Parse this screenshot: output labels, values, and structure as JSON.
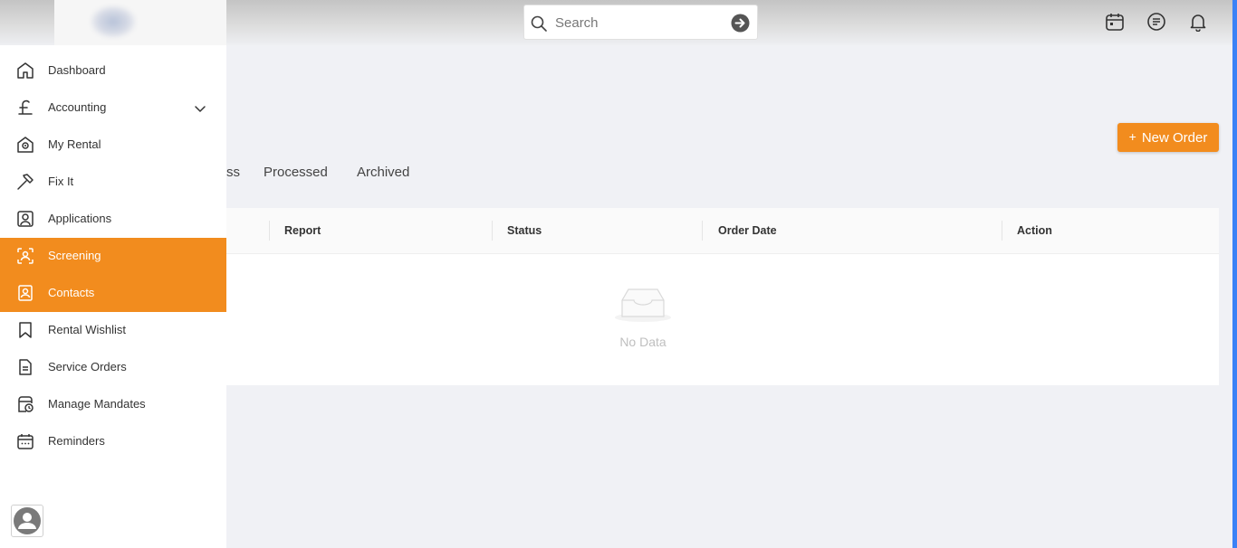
{
  "search": {
    "placeholder": "Search"
  },
  "sidebar": {
    "items": [
      {
        "label": "Dashboard",
        "icon": "home-icon"
      },
      {
        "label": "Accounting",
        "icon": "pound-icon"
      },
      {
        "label": "My Rental",
        "icon": "rental-icon"
      },
      {
        "label": "Fix It",
        "icon": "hammer-icon"
      },
      {
        "label": "Applications",
        "icon": "applications-icon"
      },
      {
        "label": "Screening",
        "icon": "screening-icon"
      },
      {
        "label": "Contacts",
        "icon": "contacts-icon"
      },
      {
        "label": "Rental Wishlist",
        "icon": "bookmark-icon"
      },
      {
        "label": "Service Orders",
        "icon": "document-icon"
      },
      {
        "label": "Manage Mandates",
        "icon": "mandate-icon"
      },
      {
        "label": "Reminders",
        "icon": "calendar-icon"
      }
    ],
    "active": [
      "Screening",
      "Contacts"
    ]
  },
  "main": {
    "new_order_label": "New Order",
    "tabs": [
      {
        "label": "ss"
      },
      {
        "label": "Processed"
      },
      {
        "label": "Archived"
      }
    ],
    "table": {
      "columns": [
        "Report",
        "Status",
        "Order Date",
        "Action"
      ],
      "empty_text": "No Data"
    }
  },
  "colors": {
    "accent": "#f28c1e",
    "background": "#f0f1f5",
    "scroll": "#3b82f6"
  }
}
